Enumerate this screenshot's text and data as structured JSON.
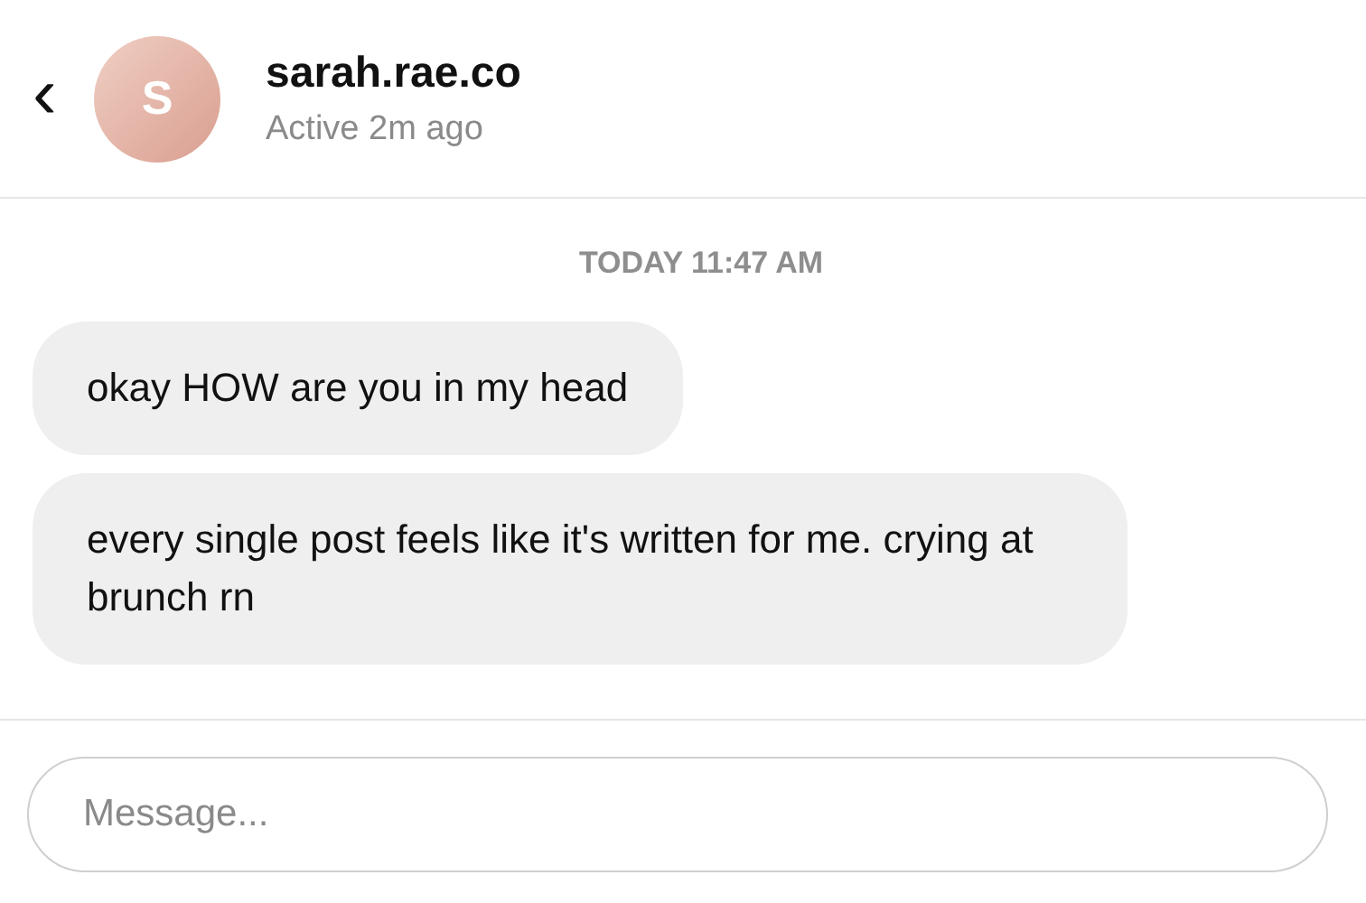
{
  "header": {
    "back": "‹",
    "avatar_letter": "S",
    "name": "sarah.rae.co",
    "status": "Active 2m ago"
  },
  "timestamp": "TODAY 11:47 AM",
  "messages": [
    {
      "text": "okay HOW are you in my head"
    },
    {
      "text": "every single post feels like it's written for me. crying at brunch rn"
    }
  ],
  "composer": {
    "placeholder": "Message..."
  }
}
